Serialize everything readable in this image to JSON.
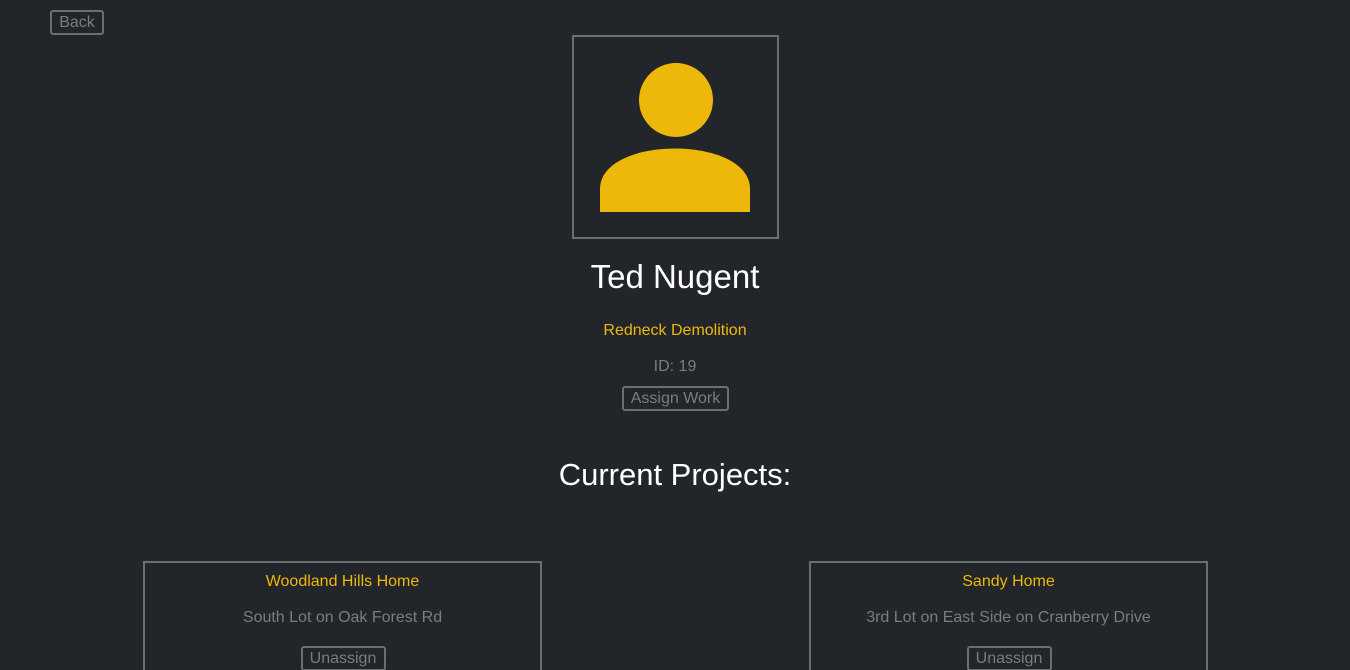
{
  "nav": {
    "back_label": "Back"
  },
  "profile": {
    "name": "Ted Nugent",
    "company": "Redneck Demolition",
    "id_text": "ID: 19",
    "assign_label": "Assign Work",
    "avatar_icon": "user-silhouette-icon",
    "avatar_color": "#eeb80a"
  },
  "projects": {
    "title": "Current Projects:",
    "items": [
      {
        "name": "Woodland Hills Home",
        "location": "South Lot on Oak Forest Rd",
        "action_label": "Unassign"
      },
      {
        "name": "Sandy Home",
        "location": "3rd Lot on East Side on Cranberry Drive",
        "action_label": "Unassign"
      }
    ]
  },
  "colors": {
    "background": "#22252a",
    "accent": "#eeb80a",
    "muted_text": "#7b7c7e",
    "border": "#6d6e70"
  }
}
